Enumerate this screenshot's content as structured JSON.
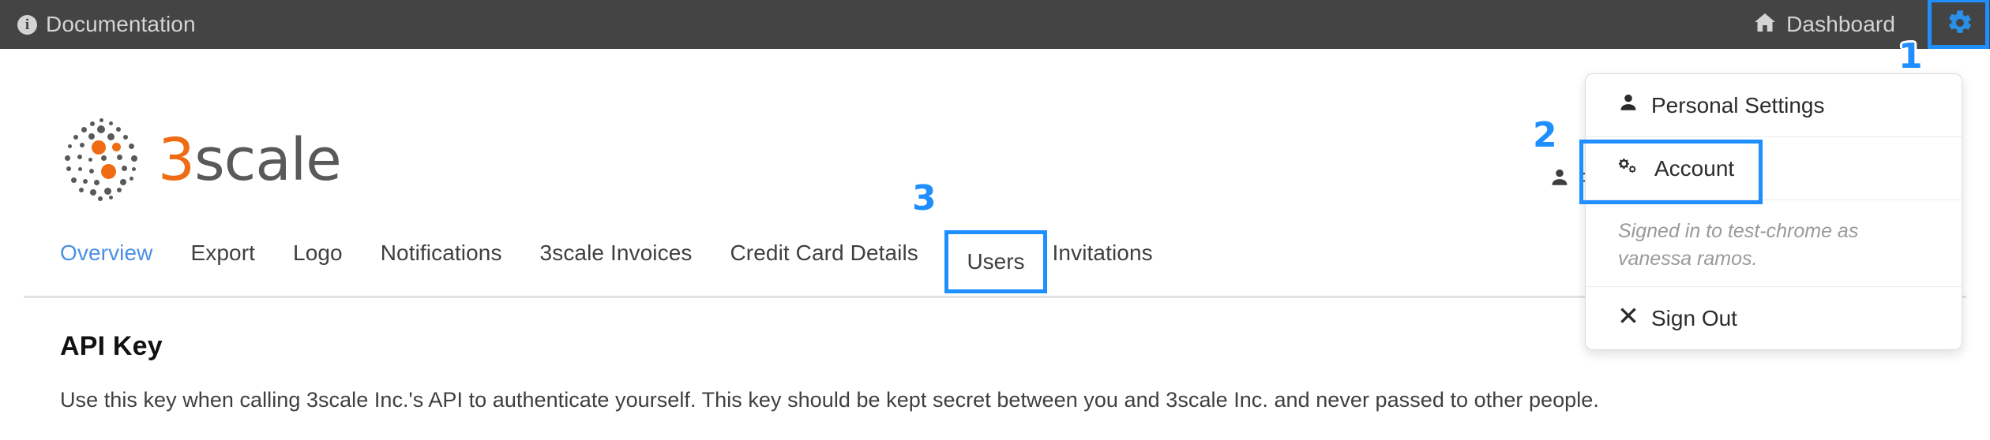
{
  "topbar": {
    "documentation_label": "Documentation",
    "documentation_icon": "info-circle-icon",
    "dashboard_label": "Dashboard",
    "dashboard_icon": "home-icon",
    "settings_icon": "gear-icon",
    "background_color": "#444444",
    "text_color": "#d4d4d4"
  },
  "brand": {
    "name_3": "3",
    "name_scale": "scale",
    "logo_icon": "3scale-dotted-circle-logo",
    "orange": "#ef6c14",
    "gray": "#58595b"
  },
  "page_user": {
    "icon": "user-icon",
    "label": "Personal Settings"
  },
  "nav": {
    "items": [
      {
        "label": "Overview",
        "active": true
      },
      {
        "label": "Export",
        "active": false
      },
      {
        "label": "Logo",
        "active": false
      },
      {
        "label": "Notifications",
        "active": false
      },
      {
        "label": "3scale Invoices",
        "active": false
      },
      {
        "label": "Credit Card Details",
        "active": false
      },
      {
        "label": "Users",
        "active": false
      },
      {
        "label": "Invitations",
        "active": false
      }
    ],
    "active_color": "#4a90e2",
    "inactive_color": "#3f3f3f"
  },
  "main": {
    "heading": "API Key",
    "description": "Use this key when calling 3scale Inc.'s API to authenticate yourself. This key should be kept secret between you and 3scale Inc. and never passed to other people."
  },
  "dropdown": {
    "items": [
      {
        "label": "Personal Settings",
        "icon": "user-icon"
      },
      {
        "label": "Account",
        "icon": "cogs-icon"
      }
    ],
    "signed_in_note": "Signed in to test-chrome as vanessa ramos.",
    "sign_out_label": "Sign Out",
    "sign_out_icon": "times-icon"
  },
  "annotations": {
    "color": "#1f8fff",
    "markers": [
      {
        "number": "1",
        "target": "gear-icon-button"
      },
      {
        "number": "2",
        "target": "account-menu-item"
      },
      {
        "number": "3",
        "target": "users-tab"
      }
    ]
  }
}
